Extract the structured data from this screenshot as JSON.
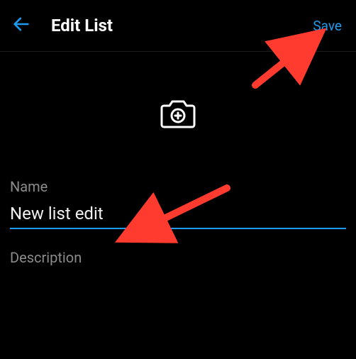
{
  "header": {
    "title": "Edit List",
    "save_label": "Save"
  },
  "photo": {
    "icon_name": "camera-add-icon"
  },
  "form": {
    "name_label": "Name",
    "name_value": "New list edit",
    "description_label": "Description",
    "description_value": ""
  },
  "colors": {
    "accent": "#1d9bf0",
    "bg": "#000000",
    "text_muted": "#8b8b8b"
  },
  "annotations": {
    "arrow_to_save": true,
    "arrow_to_name": true
  }
}
